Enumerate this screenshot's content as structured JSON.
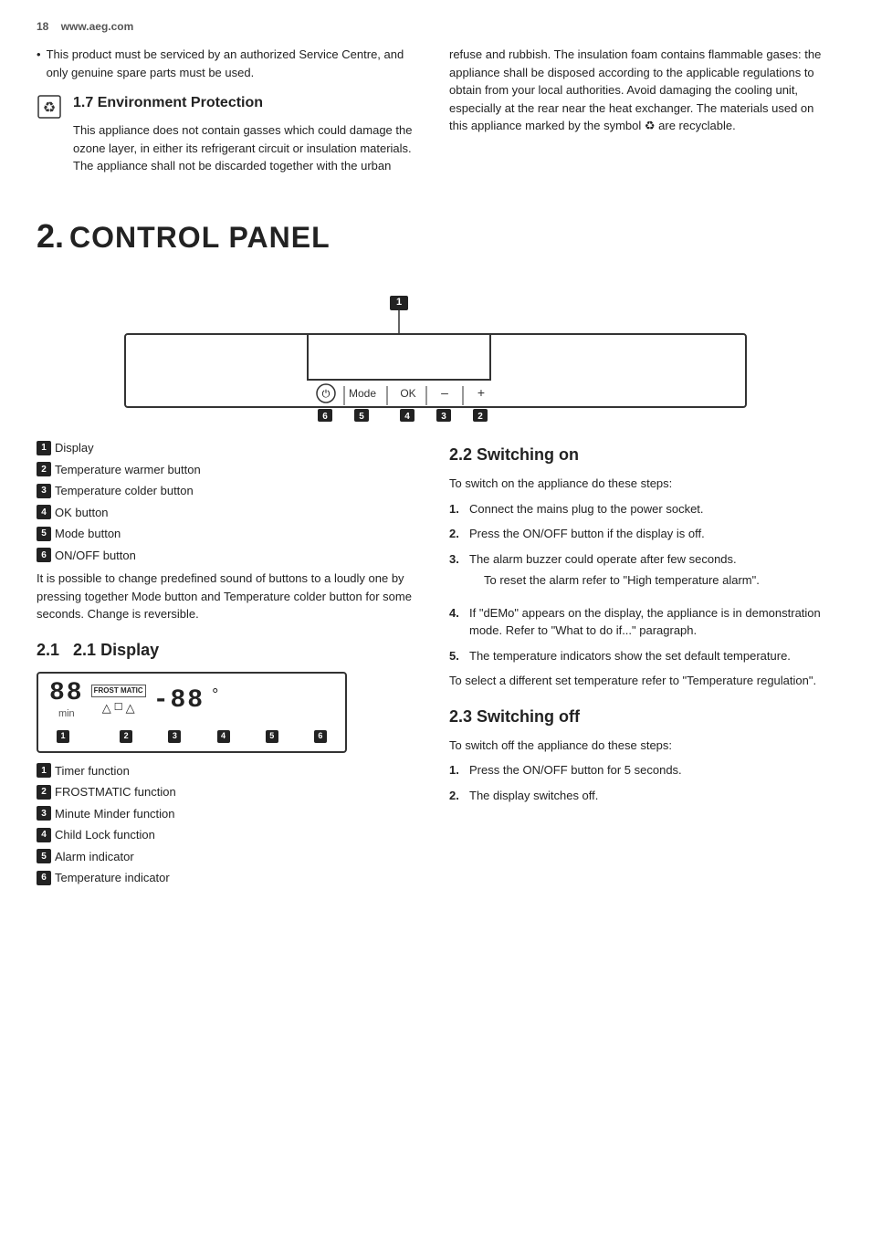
{
  "header": {
    "page_num": "18",
    "website": "www.aeg.com"
  },
  "intro": {
    "bullet": "This product must be serviced by an authorized Service Centre, and only genuine spare parts must be used.",
    "right_text": "refuse and rubbish. The insulation foam contains flammable gases: the appliance shall be disposed according to the applicable regulations to obtain from your local authorities. Avoid damaging the cooling unit, especially at the rear near the heat exchanger. The materials used on this appliance marked by the symbol ♻ are recyclable."
  },
  "env_section": {
    "heading": "1.7 Environment Protection",
    "text": "This appliance does not contain gasses which could damage the ozone layer, in either its refrigerant circuit or insulation materials. The appliance shall not be discarded together with the urban"
  },
  "chapter": {
    "num": "2.",
    "title": "CONTROL PANEL"
  },
  "control_panel": {
    "diagram_labels": {
      "power_symbol": "⏻",
      "mode": "Mode",
      "ok": "OK",
      "minus": "–",
      "plus": "+"
    },
    "numbered_labels": [
      {
        "num": "1",
        "label": "Display"
      },
      {
        "num": "2",
        "label": "Temperature warmer button"
      },
      {
        "num": "3",
        "label": "Temperature colder button"
      },
      {
        "num": "4",
        "label": "OK button"
      },
      {
        "num": "5",
        "label": "Mode button"
      },
      {
        "num": "6",
        "label": "ON/OFF button"
      }
    ],
    "extra_text": "It is possible to change predefined sound of buttons to a loudly one by pressing together Mode button and Temperature colder button for some seconds. Change is reversible."
  },
  "display_section": {
    "heading": "2.1 Display",
    "frost_matic": "FROST MATIC",
    "seg1": "88",
    "seg1_sub": "min",
    "seg2": "-88",
    "degree": "°",
    "icons": "△ ☐ △",
    "numbered_labels": [
      {
        "num": "1",
        "label": "Timer function"
      },
      {
        "num": "2",
        "label": "FROSTMATIC function"
      },
      {
        "num": "3",
        "label": "Minute Minder function"
      },
      {
        "num": "4",
        "label": "Child Lock function"
      },
      {
        "num": "5",
        "label": "Alarm indicator"
      },
      {
        "num": "6",
        "label": "Temperature indicator"
      }
    ]
  },
  "switching_on": {
    "heading": "2.2 Switching on",
    "intro": "To switch on the appliance do these steps:",
    "steps": [
      "Connect the mains plug to the power socket.",
      "Press the ON/OFF button if the display is off.",
      "The alarm buzzer could operate after few seconds.",
      "If \"dEMo\" appears on the display, the appliance is in demonstration mode. Refer to \"What to do if...\" paragraph.",
      "The temperature indicators show the set default temperature."
    ],
    "step3_sub": "To reset the alarm refer to \"High temperature alarm\".",
    "outro": "To select a different set temperature refer to \"Temperature regulation\"."
  },
  "switching_off": {
    "heading": "2.3 Switching off",
    "intro": "To switch off the appliance do these steps:",
    "steps": [
      "Press the ON/OFF button for 5 seconds.",
      "The display switches off."
    ]
  }
}
